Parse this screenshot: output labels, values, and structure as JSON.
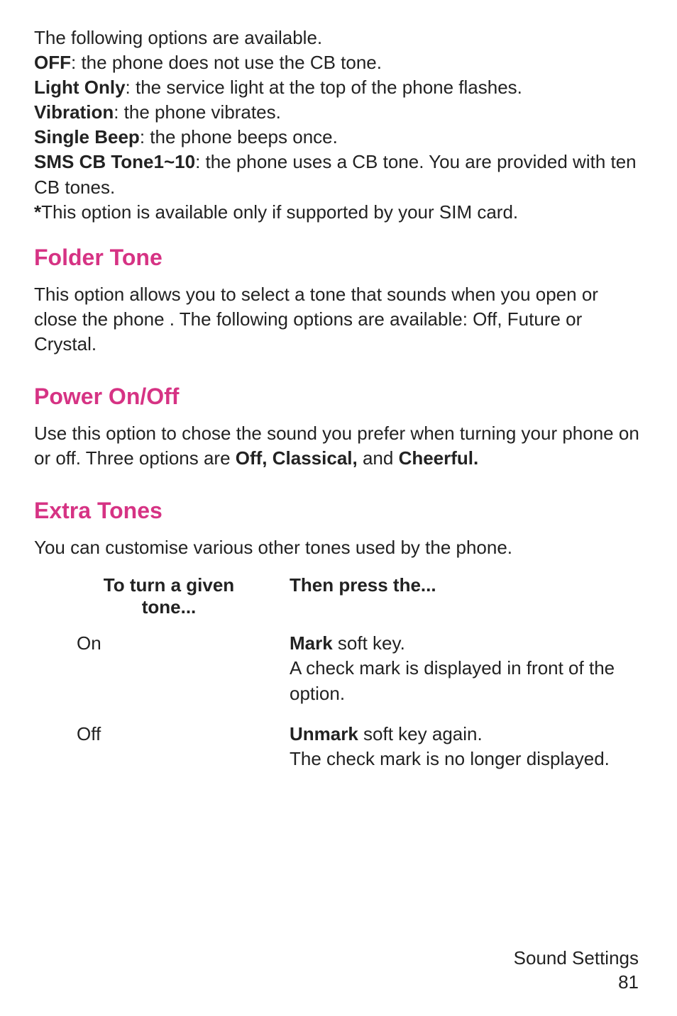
{
  "intro": {
    "line1": "The following options are available.",
    "off_label": "OFF",
    "off_text": ": the phone does not use the CB tone.",
    "light_label": "Light Only",
    "light_text": ": the service light at the top of the phone flashes.",
    "vibration_label": "Vibration",
    "vibration_text": ": the phone vibrates.",
    "beep_label": "Single Beep",
    "beep_text": ": the phone beeps once.",
    "sms_label": "SMS CB Tone1~10",
    "sms_text": ": the phone uses a CB tone. You are provided with ten CB tones.",
    "note_label": "*",
    "note_text": "This option is available only if supported by your SIM card."
  },
  "folder": {
    "heading": "Folder Tone",
    "para": "This option allows you to select a tone that sounds when you open or close the phone .  The following options are available:  Off, Future or Crystal."
  },
  "power": {
    "heading": "Power On/Off",
    "para_pre": "Use this option to chose the sound you prefer when turning your phone on or off. Three options are ",
    "para_bold": "Off, Classical,",
    "para_mid": " and ",
    "para_bold2": "Cheerful."
  },
  "extra": {
    "heading": "Extra Tones",
    "para": "You can customise various other tones used by the phone.",
    "th_left": "To turn a given tone...",
    "th_right": "Then press the...",
    "row1_left": "On",
    "row1_bold": "Mark",
    "row1_rest": " soft key.\nA check mark is displayed in front of the option.",
    "row2_left": "Off",
    "row2_bold": "Unmark",
    "row2_rest": " soft key again.\nThe check mark is no longer displayed."
  },
  "footer": {
    "title": "Sound Settings",
    "page": "81"
  }
}
